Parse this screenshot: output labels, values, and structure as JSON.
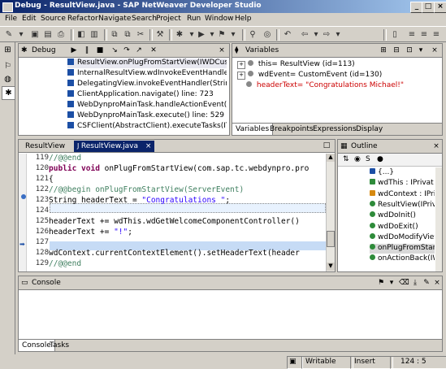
{
  "window": {
    "title": "Debug - ResultView.java - SAP NetWeaver Developer Studio"
  },
  "menu": [
    "File",
    "Edit",
    "Source",
    "Refactor",
    "Navigate",
    "Search",
    "Project",
    "Run",
    "Window",
    "Help"
  ],
  "debug_view": {
    "title": "Debug",
    "frames": [
      "ResultView.onPlugFromStartView(IWDCustomEve",
      "InternalResultView.wdInvokeEventHandler(String",
      "DelegatingView.invokeEventHandler(String, IWDC",
      "ClientApplication.navigate() line: 723",
      "WebDynproMainTask.handleActionEvent(ClientAp",
      "WebDynproMainTask.execute() line: 529",
      "CSFClient(AbstractClient).executeTasks(ITask) lin"
    ]
  },
  "variables_view": {
    "title": "Variables",
    "items": [
      {
        "text": "this= ResultView  (id=113)",
        "color": "#000000"
      },
      {
        "text": "wdEvent= CustomEvent  (id=130)",
        "color": "#000000"
      },
      {
        "text": "headerText= \"Congratulations Michael!\"",
        "color": "#cc0000"
      }
    ],
    "tabs": [
      "Variables",
      "Breakpoints",
      "Expressions",
      "Display"
    ]
  },
  "editor": {
    "tabs": [
      "ResultView",
      "ResultView.java"
    ],
    "lines": [
      {
        "num": "119",
        "text": "  //@@end"
      },
      {
        "num": "120",
        "text": "  public void onPlugFromStartView(com.sap.tc.webdynpro.pro"
      },
      {
        "num": "121",
        "text": "  {"
      },
      {
        "num": "122",
        "text": "    //@@begin onPlugFromStartView(ServerEvent)"
      },
      {
        "num": "123",
        "text": "    String headerText = \"Congratulations \";"
      },
      {
        "num": "124",
        "text": ""
      },
      {
        "num": "125",
        "text": "    headerText += wdThis.wdGetWelcomeComponentController()"
      },
      {
        "num": "126",
        "text": "    headerText += \"!\";"
      },
      {
        "num": "127",
        "text": ""
      },
      {
        "num": "128",
        "text": "    wdContext.currentContextElement().setHeaderText(header"
      },
      {
        "num": "129",
        "text": "    //@@end"
      }
    ]
  },
  "outline": {
    "title": "Outline",
    "items": [
      "{...}",
      "wdThis : IPrivat",
      "wdContext : IPri",
      "ResultView(IPriv",
      "wdDoInit()",
      "wdDoExit()",
      "wdDoModifyView",
      "onPlugFromStart",
      "onActionBack(IW"
    ]
  },
  "console": {
    "title": "Console",
    "tabs": [
      "Console",
      "Tasks"
    ]
  },
  "status": {
    "mode": "Writable",
    "insert": "Insert",
    "position": "124 : 5"
  }
}
